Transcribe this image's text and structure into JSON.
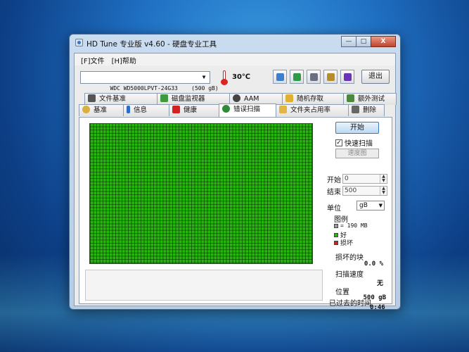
{
  "window": {
    "title": "HD Tune 专业版 v4.60 - 硬盘专业工具",
    "minimize_label": "—",
    "maximize_label": "□",
    "close_label": "X"
  },
  "menu": {
    "items": [
      {
        "label": "[F]文件"
      },
      {
        "label": "[H]帮助"
      }
    ]
  },
  "toolbar": {
    "drive_value": "WDC WD5000LPVT-24G33    (500 gB)",
    "temperature": "30℃",
    "exit_label": "退出",
    "icons": [
      "copy-icon",
      "save-icon",
      "disk-icon",
      "tools-icon",
      "download-icon"
    ]
  },
  "tabs": {
    "top": [
      {
        "label": "文件基准"
      },
      {
        "label": "磁盘监视器"
      },
      {
        "label": "AAM"
      },
      {
        "label": "随机存取"
      },
      {
        "label": "额外测试"
      }
    ],
    "bottom": [
      {
        "label": "基准"
      },
      {
        "label": "信息"
      },
      {
        "label": "健康"
      },
      {
        "label": "错误扫描"
      },
      {
        "label": "文件夹占用率"
      },
      {
        "label": "删除"
      }
    ],
    "active": "错误扫描"
  },
  "scan": {
    "start_label": "开始",
    "quick_scan_label": "快速扫描",
    "quick_scan_checked": true,
    "speed_map_label": "速度图",
    "start_field_label": "开始",
    "start_value": "0",
    "end_field_label": "结束",
    "end_value": "500",
    "unit_label": "单位",
    "unit_value": "gB",
    "legend_title": "图例",
    "legend": [
      {
        "label": "= 190 MB",
        "color": "#9a9a9a"
      },
      {
        "label": "好",
        "color": "#27b50e"
      },
      {
        "label": "损坏",
        "color": "#d42020"
      }
    ],
    "damaged_label": "损坏的块",
    "damaged_value": "0.0 %",
    "speed_label": "扫描速度",
    "speed_value": "无",
    "position_label": "位置",
    "position_value": "500 gB",
    "elapsed_label": "已过去的时间",
    "elapsed_value": "0:46"
  },
  "colors": {
    "good_block": "#27b50e",
    "bad_block": "#d42020"
  }
}
